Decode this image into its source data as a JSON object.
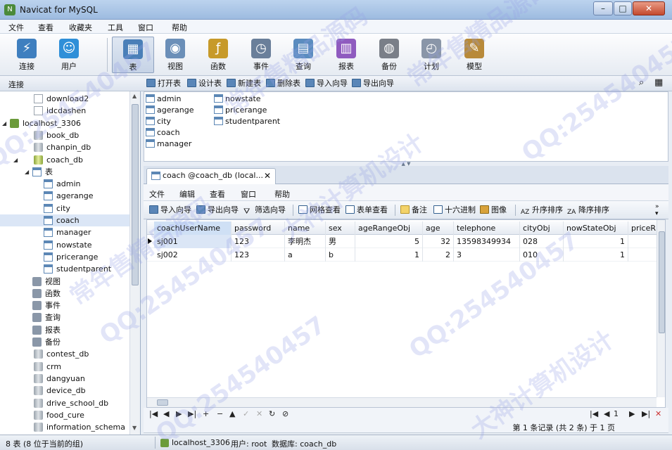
{
  "window": {
    "title": "Navicat for MySQL",
    "min": "–",
    "max": "□",
    "close": "✕"
  },
  "menu": [
    "文件",
    "查看",
    "收藏夹",
    "工具",
    "窗口",
    "帮助"
  ],
  "toolbar": [
    {
      "label": "连接",
      "icon": "connection-icon",
      "color": "#3f7fbf",
      "glyph": "⚡"
    },
    {
      "label": "用户",
      "icon": "user-icon",
      "color": "#2f8fd8",
      "glyph": "☺"
    },
    {
      "label": "表",
      "icon": "table-icon",
      "color": "#4a7fb8",
      "glyph": "▦",
      "active": true
    },
    {
      "label": "视图",
      "icon": "view-icon",
      "color": "#6b8fb8",
      "glyph": "◉"
    },
    {
      "label": "函数",
      "icon": "function-icon",
      "color": "#c79a2a",
      "glyph": "ƒ"
    },
    {
      "label": "事件",
      "icon": "event-icon",
      "color": "#6a7f9a",
      "glyph": "◷"
    },
    {
      "label": "查询",
      "icon": "query-icon",
      "color": "#5b8cbf",
      "glyph": "▤"
    },
    {
      "label": "报表",
      "icon": "report-icon",
      "color": "#8f5bbf",
      "glyph": "▥"
    },
    {
      "label": "备份",
      "icon": "backup-icon",
      "color": "#7a7f88",
      "glyph": "◍"
    },
    {
      "label": "计划",
      "icon": "schedule-icon",
      "color": "#8a96a8",
      "glyph": "◴"
    },
    {
      "label": "模型",
      "icon": "model-icon",
      "color": "#b88a3a",
      "glyph": "✎"
    }
  ],
  "subbar": {
    "connection_label": "连接",
    "actions": [
      "打开表",
      "设计表",
      "新建表",
      "删除表",
      "导入向导",
      "导出向导"
    ]
  },
  "tree": [
    {
      "text": "download2",
      "level": 1,
      "icon": "file",
      "twisty": ""
    },
    {
      "text": "idcdashen",
      "level": 1,
      "icon": "file",
      "twisty": ""
    },
    {
      "text": "localhost_3306",
      "level": 0,
      "icon": "server",
      "twisty": "◢"
    },
    {
      "text": "book_db",
      "level": 1,
      "icon": "db",
      "twisty": ""
    },
    {
      "text": "chanpin_db",
      "level": 1,
      "icon": "db",
      "twisty": ""
    },
    {
      "text": "coach_db",
      "level": 1,
      "icon": "dbopen",
      "twisty": "◢"
    },
    {
      "text": "表",
      "level": 2,
      "icon": "table",
      "twisty": "◢"
    },
    {
      "text": "admin",
      "level": 3,
      "icon": "table",
      "twisty": ""
    },
    {
      "text": "agerange",
      "level": 3,
      "icon": "table",
      "twisty": ""
    },
    {
      "text": "city",
      "level": 3,
      "icon": "table",
      "twisty": ""
    },
    {
      "text": "coach",
      "level": 3,
      "icon": "table",
      "twisty": "",
      "selected": true
    },
    {
      "text": "manager",
      "level": 3,
      "icon": "table",
      "twisty": ""
    },
    {
      "text": "nowstate",
      "level": 3,
      "icon": "table",
      "twisty": ""
    },
    {
      "text": "pricerange",
      "level": 3,
      "icon": "table",
      "twisty": ""
    },
    {
      "text": "studentparent",
      "level": 3,
      "icon": "table",
      "twisty": ""
    },
    {
      "text": "视图",
      "level": 2,
      "icon": "small",
      "twisty": ""
    },
    {
      "text": "函数",
      "level": 2,
      "icon": "small",
      "twisty": ""
    },
    {
      "text": "事件",
      "level": 2,
      "icon": "small",
      "twisty": ""
    },
    {
      "text": "查询",
      "level": 2,
      "icon": "small",
      "twisty": ""
    },
    {
      "text": "报表",
      "level": 2,
      "icon": "small",
      "twisty": ""
    },
    {
      "text": "备份",
      "level": 2,
      "icon": "small",
      "twisty": ""
    },
    {
      "text": "contest_db",
      "level": 1,
      "icon": "db",
      "twisty": ""
    },
    {
      "text": "crm",
      "level": 1,
      "icon": "db",
      "twisty": ""
    },
    {
      "text": "dangyuan",
      "level": 1,
      "icon": "db",
      "twisty": ""
    },
    {
      "text": "device_db",
      "level": 1,
      "icon": "db",
      "twisty": ""
    },
    {
      "text": "drive_school_db",
      "level": 1,
      "icon": "db",
      "twisty": ""
    },
    {
      "text": "food_cure",
      "level": 1,
      "icon": "db",
      "twisty": ""
    },
    {
      "text": "information_schema",
      "level": 1,
      "icon": "db",
      "twisty": ""
    }
  ],
  "objects": {
    "col1": [
      "admin",
      "agerange",
      "city",
      "coach",
      "manager"
    ],
    "col2": [
      "nowstate",
      "pricerange",
      "studentparent"
    ]
  },
  "tab": {
    "label": "coach @coach_db (local...",
    "close": "✕"
  },
  "inner_menu": [
    "文件",
    "编辑",
    "查看",
    "窗口",
    "帮助"
  ],
  "inner_tools": [
    "导入向导",
    "导出向导",
    "筛选向导",
    "网格查看",
    "表单查看",
    "备注",
    "十六进制",
    "图像",
    "升序排序",
    "降序排序"
  ],
  "grid": {
    "columns": [
      "coachUserName",
      "password",
      "name",
      "sex",
      "ageRangeObj",
      "age",
      "telephone",
      "cityObj",
      "nowStateObj",
      "priceR"
    ],
    "rows": [
      [
        "sj001",
        "123",
        "李明杰",
        "男",
        "5",
        "32",
        "13598349934",
        "028",
        "1",
        ""
      ],
      [
        "sj002",
        "123",
        "a",
        "b",
        "1",
        "2",
        "3",
        "010",
        "1",
        ""
      ]
    ],
    "current_row": 0
  },
  "navbar": [
    "|◀",
    "◀",
    "▶",
    "▶|",
    "+",
    "−",
    "▲",
    "✓",
    "✕",
    "↻",
    "⊘"
  ],
  "nav_right": [
    "|◀",
    "◀",
    "1",
    "▶",
    "▶|",
    "✕"
  ],
  "page_info": "第 1 条记录 (共 2 条) 于 1 页",
  "status": {
    "count": "8 表 (8 位于当前的组)",
    "connection": "localhost_3306",
    "user": "用户: root",
    "database": "数据库: coach_db"
  },
  "watermarks": [
    "QQ:254540457",
    "大神计算机设计",
    "常年售精品源码"
  ]
}
